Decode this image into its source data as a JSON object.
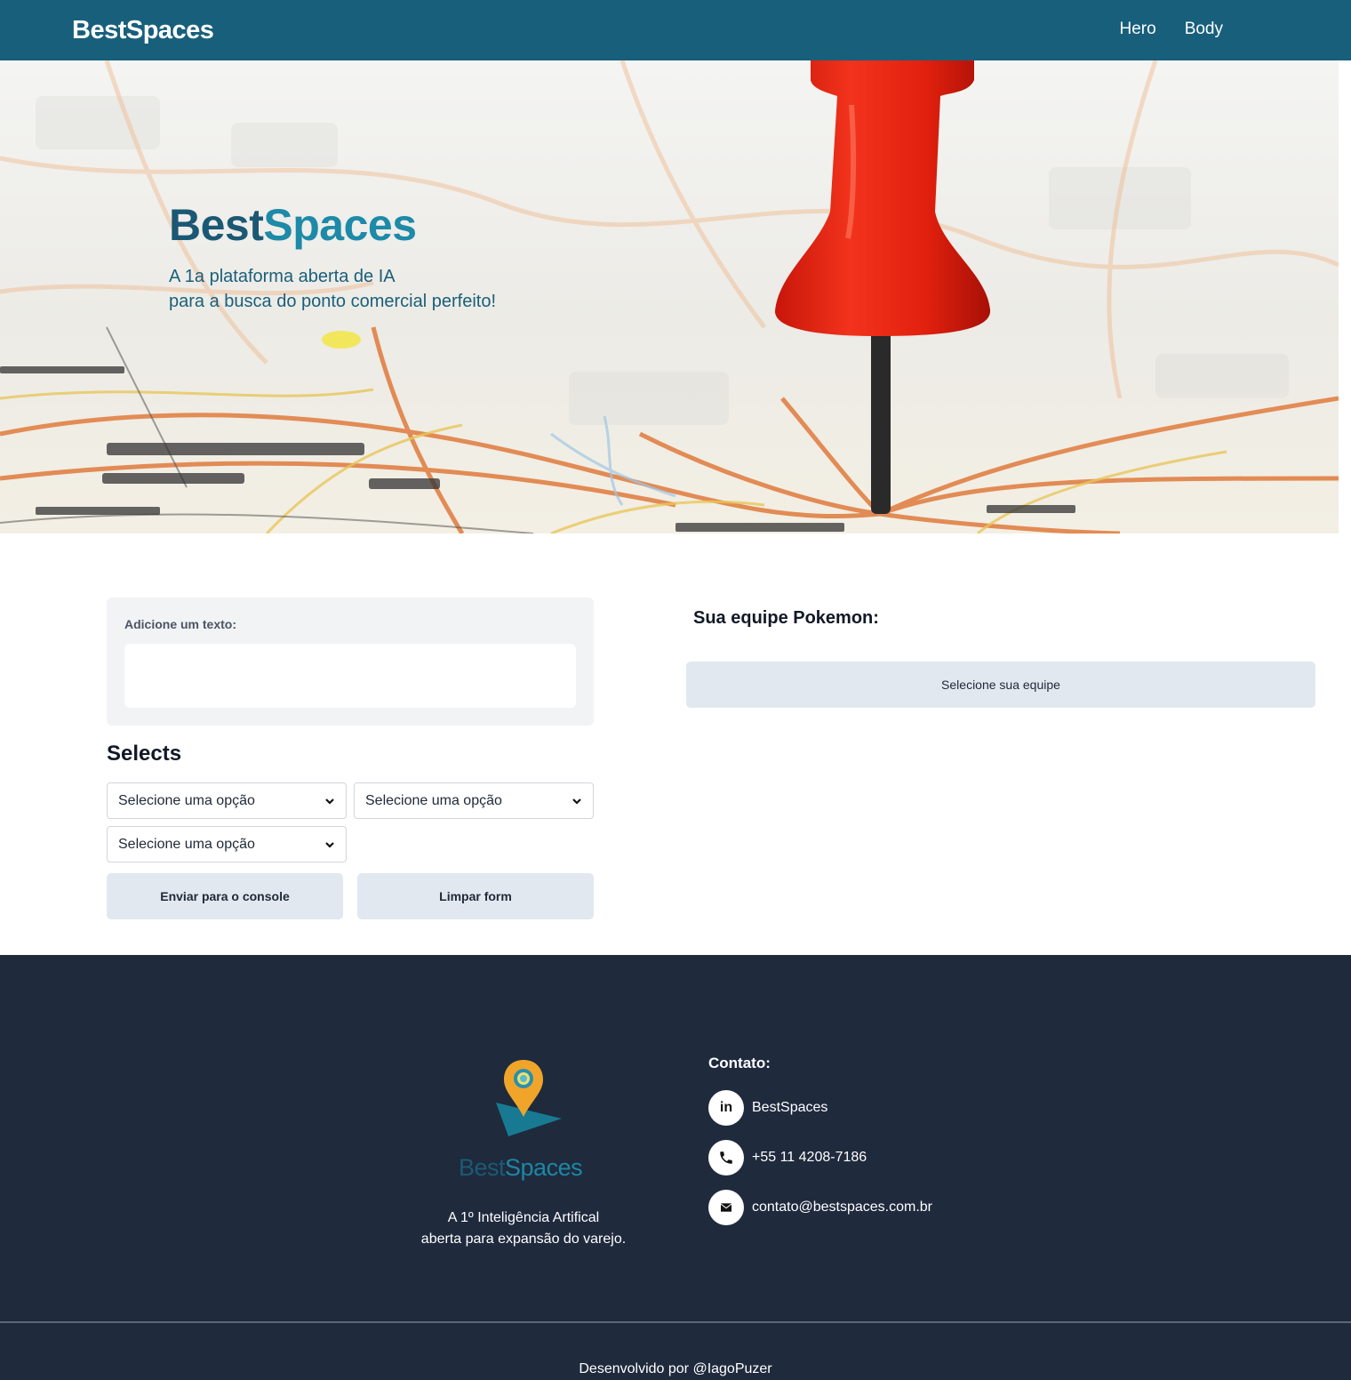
{
  "header": {
    "brand": "BestSpaces",
    "nav": [
      {
        "label": "Hero"
      },
      {
        "label": "Body"
      }
    ]
  },
  "hero": {
    "title_part1": "Best",
    "title_part2": "Spaces",
    "subtitle_line1": "A 1a plataforma aberta de IA",
    "subtitle_line2": "para a busca do ponto comercial perfeito!"
  },
  "form": {
    "text_label": "Adicione um texto:",
    "text_value": "",
    "selects_title": "Selects",
    "selects": [
      {
        "value": "Selecione uma opção"
      },
      {
        "value": "Selecione uma opção"
      },
      {
        "value": "Selecione uma opção"
      }
    ],
    "send_button": "Enviar para o console",
    "clear_button": "Limpar form"
  },
  "team": {
    "title": "Sua equipe Pokemon:",
    "button": "Selecione sua equipe"
  },
  "footer": {
    "logo_part1": "Best",
    "logo_part2": "Spaces",
    "tagline_line1": "A 1º Inteligência Artifical",
    "tagline_line2": "aberta para expansão do varejo.",
    "contact_title": "Contato:",
    "contacts": [
      {
        "icon": "linkedin-icon",
        "glyph": "in",
        "text": "BestSpaces"
      },
      {
        "icon": "phone-icon",
        "glyph": "",
        "text": "+55 11 4208-7186"
      },
      {
        "icon": "mail-icon",
        "glyph": "",
        "text": "contato@bestspaces.com.br"
      }
    ],
    "credits": "Desenvolvido por @IagoPuzer"
  },
  "colors": {
    "header_bg": "#185f7b",
    "brand_dark": "#1b5874",
    "brand_light": "#1d8aa8",
    "footer_bg": "#1f2a3d",
    "button_bg": "#e2e8f0",
    "pin_red": "#e8200f",
    "logo_orange": "#f0a52a"
  }
}
